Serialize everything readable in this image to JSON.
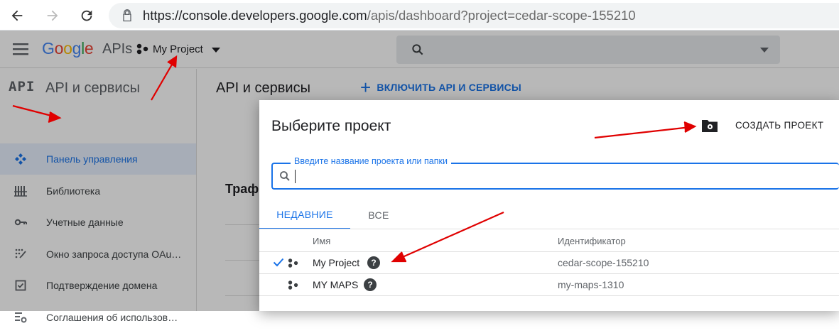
{
  "browser": {
    "url_host": "https://console.developers.google.com",
    "url_path": "/apis/dashboard?project=cedar-scope-155210"
  },
  "header": {
    "logo_letters": [
      {
        "ch": "G",
        "color": "#4285F4"
      },
      {
        "ch": "o",
        "color": "#EA4335"
      },
      {
        "ch": "o",
        "color": "#FBBC05"
      },
      {
        "ch": "g",
        "color": "#4285F4"
      },
      {
        "ch": "l",
        "color": "#34A853"
      },
      {
        "ch": "e",
        "color": "#EA4335"
      }
    ],
    "logo_suffix": "APIs",
    "project_name": "My Project"
  },
  "sidebar": {
    "logo": "API",
    "title": "API и сервисы",
    "items": [
      {
        "label": "Панель управления",
        "icon": "dashboard-icon",
        "active": true
      },
      {
        "label": "Библиотека",
        "icon": "library-icon",
        "active": false
      },
      {
        "label": "Учетные данные",
        "icon": "key-icon",
        "active": false
      },
      {
        "label": "Окно запроса доступа OAu…",
        "icon": "consent-icon",
        "active": false
      },
      {
        "label": "Подтверждение домена",
        "icon": "checkbox-icon",
        "active": false
      },
      {
        "label": "Соглашения об использов…",
        "icon": "settings-list-icon",
        "active": false
      }
    ]
  },
  "main": {
    "title": "API и сервисы",
    "enable_label": "ВКЛЮЧИТЬ API И СЕРВИСЫ",
    "traffic_partial": "Траф"
  },
  "dialog": {
    "title": "Выберите проект",
    "create_label": "СОЗДАТЬ ПРОЕКТ",
    "search_label": "Введите название проекта или папки",
    "search_value": "",
    "tabs": [
      {
        "label": "НЕДАВНИЕ",
        "active": true
      },
      {
        "label": "ВСЕ",
        "active": false
      }
    ],
    "columns": {
      "name": "Имя",
      "id": "Идентификатор"
    },
    "projects": [
      {
        "name": "My Project",
        "id": "cedar-scope-155210",
        "selected": true
      },
      {
        "name": "MY MAPS",
        "id": "my-maps-1310",
        "selected": false
      }
    ]
  },
  "colors": {
    "accent": "#1a73e8",
    "annotation_red": "#e00000",
    "active_bg": "#e8f0fe"
  }
}
